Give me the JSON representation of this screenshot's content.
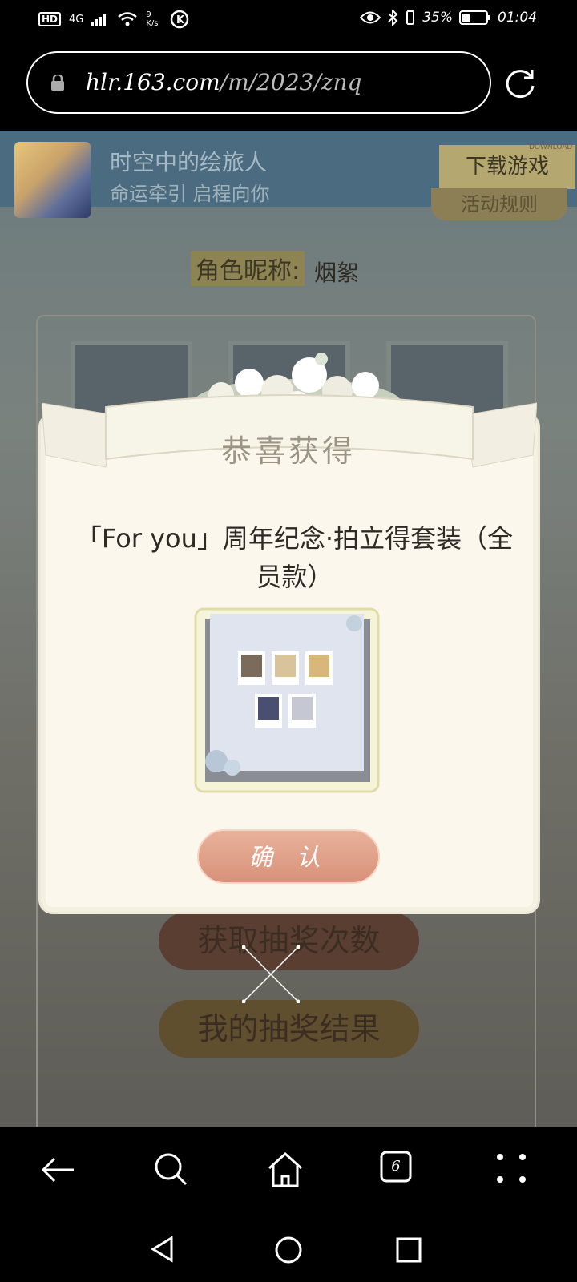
{
  "status_bar": {
    "network": "4G",
    "speed": "9 K/s",
    "battery": "35%",
    "time": "01:04"
  },
  "url_bar": {
    "domain": "hlr.163.com",
    "path": "/m/2023/znq"
  },
  "banner": {
    "app_name": "时空中的绘旅人",
    "app_subtitle": "命运牵引 启程向你",
    "download_button": "下载游戏",
    "download_tag": "DOWNLOAD",
    "rules_button": "活动规则"
  },
  "page": {
    "nickname_label": "角色昵称:",
    "nickname_value": "烟絮",
    "get_draws_button": "获取抽奖次数",
    "my_results_button": "我的抽奖结果"
  },
  "modal": {
    "ribbon_title": "恭喜获得",
    "prize_name": "「For you」周年纪念·拍立得套装（全员款）",
    "confirm_button": "确 认"
  },
  "nav": {
    "tabs_count": "6"
  }
}
